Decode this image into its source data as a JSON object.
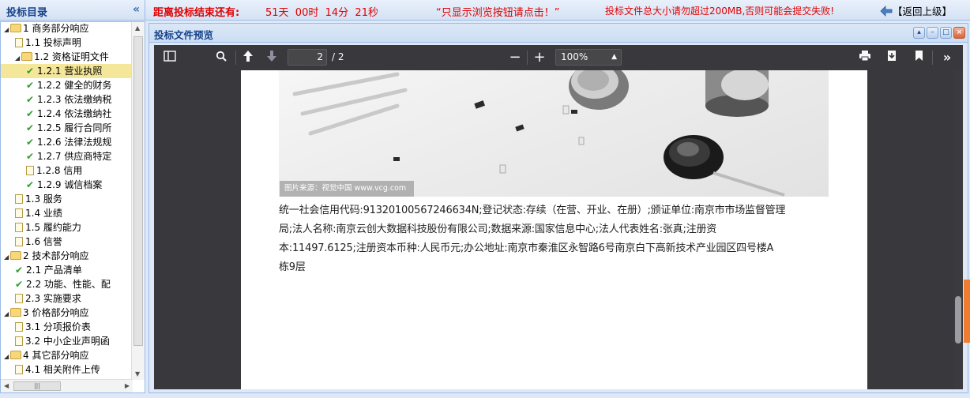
{
  "header": {
    "panel_title": "投标目录",
    "countdown_label": "距离投标结束还有:",
    "countdown_value": "51天  00时  14分  21秒",
    "browse_notice": "“只显示浏览按钮请点击！”",
    "size_warning": "投标文件总大小请勿超过200MB,否则可能会提交失败!",
    "back_label": "【返回上级】"
  },
  "tree": {
    "items": [
      {
        "label": "1 商务部分响应",
        "type": "folder",
        "level": 0,
        "expanded": true
      },
      {
        "label": "1.1 投标声明",
        "type": "doc",
        "level": 1
      },
      {
        "label": "1.2 资格证明文件",
        "type": "folder",
        "level": 1,
        "expanded": true
      },
      {
        "label": "1.2.1 营业执照",
        "type": "check",
        "level": 2,
        "selected": true
      },
      {
        "label": "1.2.2 健全的财务",
        "type": "check",
        "level": 2
      },
      {
        "label": "1.2.3 依法缴纳税",
        "type": "check",
        "level": 2
      },
      {
        "label": "1.2.4 依法缴纳社",
        "type": "check",
        "level": 2
      },
      {
        "label": "1.2.5 履行合同所",
        "type": "check",
        "level": 2
      },
      {
        "label": "1.2.6 法律法规规",
        "type": "check",
        "level": 2
      },
      {
        "label": "1.2.7 供应商特定",
        "type": "check",
        "level": 2
      },
      {
        "label": "1.2.8 信用",
        "type": "doc",
        "level": 2
      },
      {
        "label": "1.2.9 诚信档案",
        "type": "check",
        "level": 2
      },
      {
        "label": "1.3 服务",
        "type": "doc",
        "level": 1
      },
      {
        "label": "1.4 业绩",
        "type": "doc",
        "level": 1
      },
      {
        "label": "1.5 履约能力",
        "type": "doc",
        "level": 1
      },
      {
        "label": "1.6 信誉",
        "type": "doc",
        "level": 1
      },
      {
        "label": "2 技术部分响应",
        "type": "folder",
        "level": 0,
        "expanded": true
      },
      {
        "label": "2.1 产品清单",
        "type": "check",
        "level": 1
      },
      {
        "label": "2.2 功能、性能、配",
        "type": "check",
        "level": 1
      },
      {
        "label": "2.3 实施要求",
        "type": "doc",
        "level": 1
      },
      {
        "label": "3 价格部分响应",
        "type": "folder",
        "level": 0,
        "expanded": true
      },
      {
        "label": "3.1 分项报价表",
        "type": "doc",
        "level": 1
      },
      {
        "label": "3.2 中小企业声明函",
        "type": "doc",
        "level": 1
      },
      {
        "label": "4 其它部分响应",
        "type": "folder",
        "level": 0,
        "expanded": true
      },
      {
        "label": "4.1 相关附件上传",
        "type": "doc",
        "level": 1
      }
    ]
  },
  "preview": {
    "title": "投标文件预览",
    "toolbar": {
      "current_page": "2",
      "total_pages": "/ 2",
      "zoom": "100%"
    },
    "page": {
      "watermark": "图片来源：视觉中国 www.vcg.com",
      "text_lines": [
        "统一社会信用代码:91320100567246634N;登记状态:存续（在营、开业、在册）;颁证单位:南京市市场监督管理",
        "局;法人名称:南京云创大数据科技股份有限公司;数据来源:国家信息中心;法人代表姓名:张真;注册资",
        "本:11497.6125;注册资本币种:人民币元;办公地址:南京市秦淮区永智路6号南京白下高新技术产业园区四号楼A",
        "栋9层"
      ]
    }
  },
  "colors": {
    "accent": "#15428b",
    "warning": "#e00000",
    "toolbar": "#38383d",
    "selection": "#f5e79a"
  }
}
